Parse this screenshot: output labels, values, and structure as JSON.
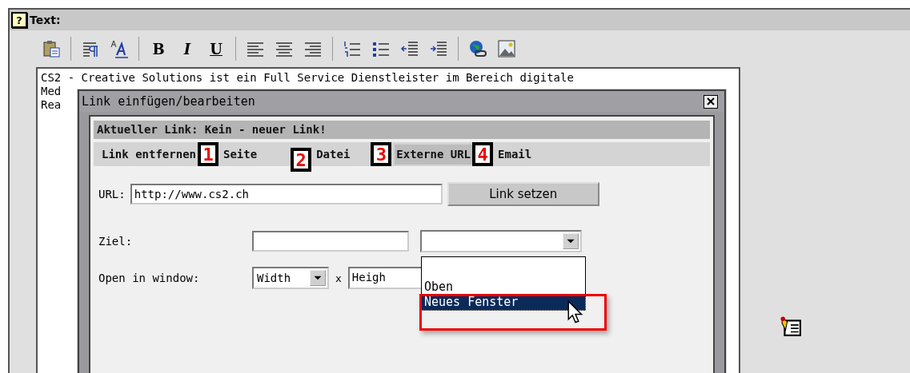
{
  "help_icon": "?",
  "field_label": "Text:",
  "format_buttons": [
    "B",
    "I",
    "U"
  ],
  "editor_lines": [
    "CS2 - Creative Solutions ist ein Full Service Dienstleister im Bereich digitale",
    "Med",
    "Rea"
  ],
  "dialog": {
    "title": "Link einfügen/bearbeiten",
    "current_link": "Aktueller Link: Kein - neuer Link!",
    "tabs": [
      {
        "label": "Link entfernen",
        "selected": false
      },
      {
        "label": "Seite",
        "selected": false,
        "badge": "1"
      },
      {
        "label": "Datei",
        "selected": false,
        "badge": "2"
      },
      {
        "label": "Externe URL",
        "selected": true,
        "badge": "3"
      },
      {
        "label": "Email",
        "selected": false,
        "badge": "4"
      }
    ],
    "url_label": "URL:",
    "url_value": "http://www.cs2.ch",
    "set_button": "Link setzen",
    "target_label": "Ziel:",
    "target_options": [
      {
        "label": "Oben",
        "selected": false
      },
      {
        "label": "Neues Fenster",
        "selected": true
      }
    ],
    "window_label": "Open in window:",
    "width_select": "Width",
    "times": "x",
    "height_value": "Heigh"
  }
}
